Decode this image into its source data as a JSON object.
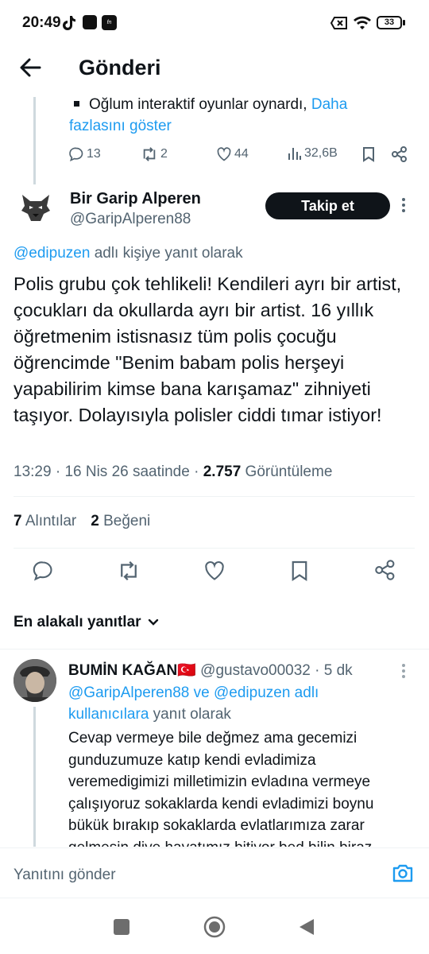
{
  "status_bar": {
    "time": "20:49",
    "battery": "33"
  },
  "header": {
    "title": "Gönderi"
  },
  "previous_tweet": {
    "text": "Oğlum interaktif oyunlar oynardı,",
    "show_more": "Daha fazlasını göster",
    "replies": "13",
    "reposts": "2",
    "likes": "44",
    "views": "32,6B"
  },
  "tweet": {
    "author_name": "Bir Garip Alperen",
    "author_handle": "@GaripAlperen88",
    "follow_label": "Takip et",
    "reply_to_handle": "@edipuzen",
    "reply_to_suffix": "adlı kişiye yanıt olarak",
    "text": "Polis grubu çok tehlikeli! Kendileri ayrı bir artist, çocukları da okullarda ayrı bir artist. 16 yıllık öğretmenim istisnasız tüm polis çocuğu öğrencimde \"Benim babam polis herşeyi yapabilirim kimse bana karışamaz\" zihniyeti taşıyor. Dolayısıyla polisler ciddi tımar istiyor!",
    "time": "13:29",
    "date": "16 Nis 26 saatinde",
    "views_count": "2.757",
    "views_label": "Görüntüleme",
    "quotes_count": "7",
    "quotes_label": "Alıntılar",
    "likes_count": "2",
    "likes_label": "Beğeni"
  },
  "sort": {
    "label": "En alakalı yanıtlar"
  },
  "reply": {
    "name": "BUMİN KAĞAN",
    "flag": "🇹🇷",
    "handle": "@gustavo00032",
    "age": "5 dk",
    "mention_text": "@GaripAlperen88 ve @edipuzen adlı kullanıcılara",
    "mention_suffix": "yanıt olarak",
    "text": "Cevap vermeye bile değmez ama gecemizi gunduzumuze katıp kendi evladimiza veremedigimizi milletimizin evladına vermeye çalışıyoruz sokaklarda kendi evladimizi boynu bükük bırakıp sokaklarda evlatlarımıza zarar gelmesin diye hayatımız bitiyor bed bilin biraz"
  },
  "composer": {
    "placeholder": "Yanıtını gönder"
  },
  "colors": {
    "accent": "#1d9bf0",
    "text": "#0f1419",
    "muted": "#536471",
    "divider": "#eff3f4"
  }
}
